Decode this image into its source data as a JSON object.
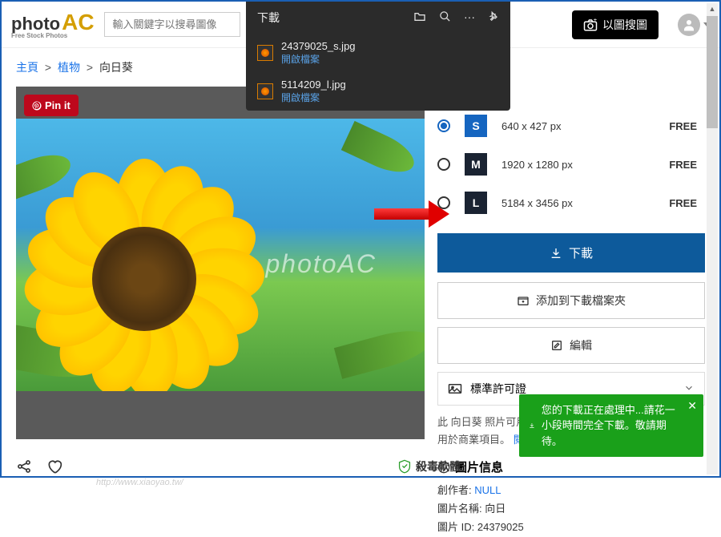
{
  "header": {
    "logo_main": "photo",
    "logo_ac": "AC",
    "logo_sub": "Free Stock Photos",
    "search_placeholder": "輸入關鍵字以搜尋圖像",
    "img_search_label": "以圖搜圖"
  },
  "breadcrumb": {
    "home": "主頁",
    "category": "植物",
    "current": "向日葵"
  },
  "pin_label": "Pin it",
  "watermark_text": "photoAC",
  "sizes": [
    {
      "code": "S",
      "dim": "640 x 427 px",
      "price": "FREE",
      "selected": true
    },
    {
      "code": "M",
      "dim": "1920 x 1280 px",
      "price": "FREE",
      "selected": false
    },
    {
      "code": "L",
      "dim": "5184 x 3456 px",
      "price": "FREE",
      "selected": false
    }
  ],
  "buttons": {
    "download": "下載",
    "add_folder": "添加到下載檔案夾",
    "edit": "編輯"
  },
  "license": {
    "label": "標準許可證"
  },
  "desc_prefix": "此 向日葵 照片可用於個人項目。在某些情況下，它也可以用於商業項目。",
  "desc_link": "閱讀更多",
  "info": {
    "title": "圖片信息",
    "creator_label": "創作者:",
    "creator_value": "NULL",
    "name_label": "圖片名稱:",
    "name_value": "向日",
    "id_label": "圖片 ID:",
    "id_value": "24379025"
  },
  "dl_panel": {
    "title": "下載",
    "items": [
      {
        "file": "24379025_s.jpg",
        "action": "開啟檔案"
      },
      {
        "file": "5114209_l.jpg",
        "action": "開啟檔案"
      }
    ]
  },
  "toast": {
    "text": "您的下載正在處理中...請花一小段時間完全下載。敬請期待。"
  },
  "antivirus": "殺毒軟體",
  "watermark2": "http://www.xiaoyao.tw/"
}
